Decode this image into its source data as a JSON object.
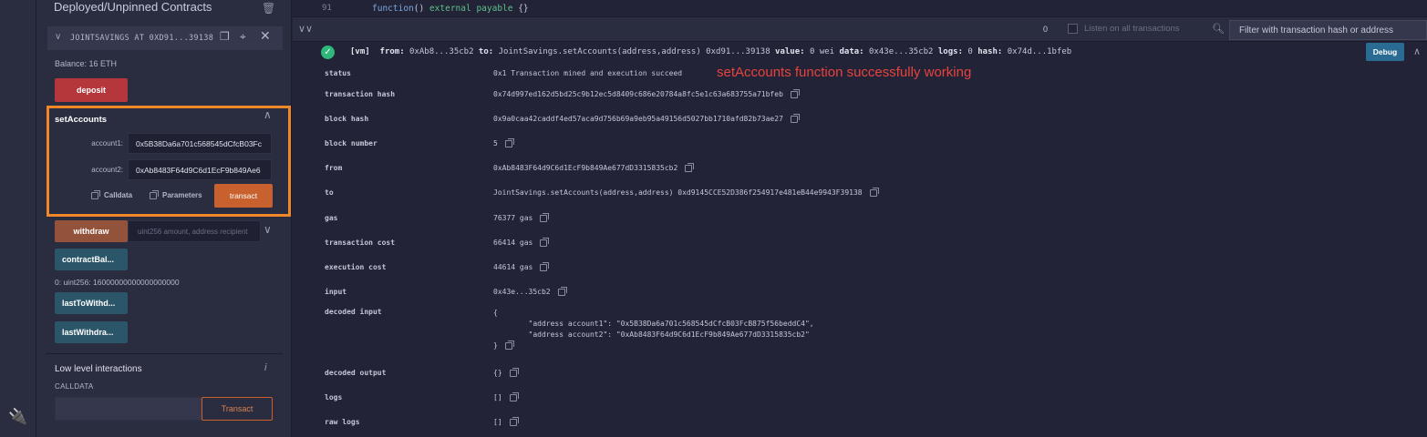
{
  "side_panel": {
    "deployed_title": "Deployed/Unpinned Contracts",
    "contract_name": "JOINTSAVINGS AT 0XD91...39138 (M",
    "balance": "Balance: 16 ETH",
    "deposit_label": "deposit",
    "set_accounts": {
      "title": "setAccounts",
      "account1_label": "account1:",
      "account1_value": "0x5B38Da6a701c568545dCfcB03Fc",
      "account2_label": "account2:",
      "account2_value": "0xAb8483F64d9C6d1EcF9b849Ae6",
      "calldata_label": "Calldata",
      "parameters_label": "Parameters",
      "transact_label": "transact"
    },
    "withdraw_label": "withdraw",
    "withdraw_placeholder": "uint256 amount, address recipient",
    "contract_balance_label": "contractBal...",
    "contract_balance_output": "0: uint256: 16000000000000000000",
    "last_to_withdraw_label": "lastToWithd...",
    "last_withdraw_amount_label": "lastWithdra...",
    "low_level": {
      "title": "Low level interactions",
      "calldata_label": "CALLDATA",
      "transact_label": "Transact"
    }
  },
  "editor": {
    "line_number": "91",
    "code_func": "function",
    "code_mid": "() ",
    "code_kw1": "external",
    "code_kw2": "payable",
    "code_end": " {}"
  },
  "terminal_bar": {
    "count": "0",
    "listen_label": "Listen on all transactions",
    "filter_placeholder": "Filter with transaction hash or address"
  },
  "log": {
    "summary_vm": "[vm]",
    "summary_from_k": "from:",
    "summary_from_v": "0xAb8...35cb2",
    "summary_to_k": "to:",
    "summary_to_v": "JointSavings.setAccounts(address,address) 0xd91...39138",
    "summary_value_k": "value:",
    "summary_value_v": "0 wei",
    "summary_data_k": "data:",
    "summary_data_v": "0x43e...35cb2",
    "summary_logs_k": "logs:",
    "summary_logs_v": "0",
    "summary_hash_k": "hash:",
    "summary_hash_v": "0x74d...1bfeb",
    "debug_label": "Debug",
    "annotation": "setAccounts function successfully working",
    "rows": [
      {
        "key": "status",
        "value": "0x1 Transaction mined and execution succeed"
      },
      {
        "key": "transaction hash",
        "value": "0x74d997ed162d5bd25c9b12ec5d8409c686e20784a8fc5e1c63a683755a71bfeb"
      },
      {
        "key": "block hash",
        "value": "0x9a0caa42caddf4ed57aca9d756b69a9eb95a49156d5027bb1710afd82b73ae27"
      },
      {
        "key": "block number",
        "value": "5"
      },
      {
        "key": "from",
        "value": "0xAb8483F64d9C6d1EcF9b849Ae677dD3315835cb2"
      },
      {
        "key": "to",
        "value": "JointSavings.setAccounts(address,address) 0xd9145CCE52D386f254917e481eB44e9943F39138"
      },
      {
        "key": "gas",
        "value": "76377 gas"
      },
      {
        "key": "transaction cost",
        "value": "66414 gas"
      },
      {
        "key": "execution cost",
        "value": "44614 gas"
      },
      {
        "key": "input",
        "value": "0x43e...35cb2"
      },
      {
        "key": "decoded input",
        "value": ""
      },
      {
        "key": "decoded output",
        "value": "{}"
      },
      {
        "key": "logs",
        "value": "[]"
      },
      {
        "key": "raw logs",
        "value": "[]"
      }
    ],
    "decoded_input": "{\n        \"address account1\": \"0x5B38Da6a701c568545dCfcB03FcB875f56beddC4\",\n        \"address account2\": \"0xAb8483F64d9C6d1EcF9b849Ae677dD3315835cb2\"\n}"
  }
}
